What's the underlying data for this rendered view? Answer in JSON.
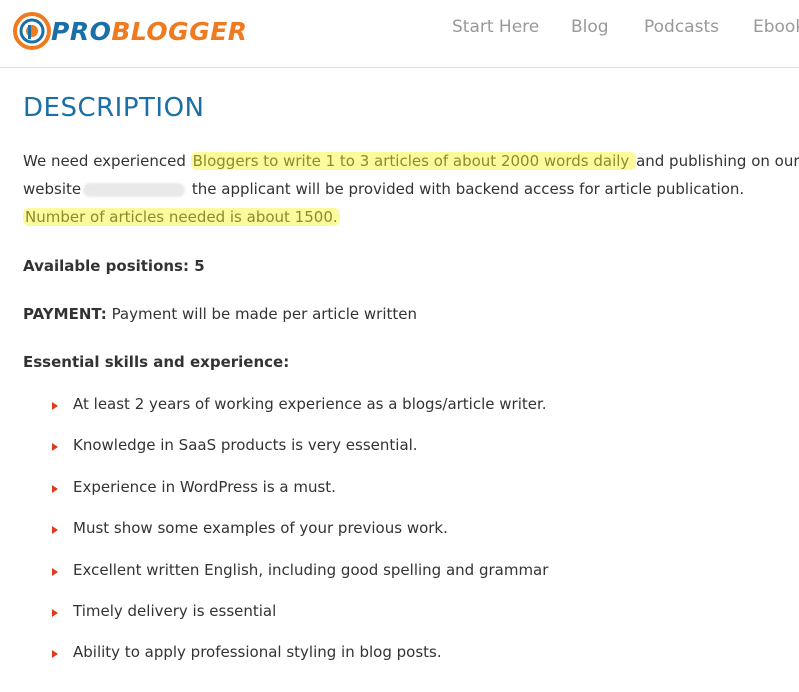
{
  "header": {
    "logo": {
      "pro": "PRO",
      "blogger": "BLOGGER"
    },
    "nav": [
      {
        "label": "Start Here"
      },
      {
        "label": "Blog"
      },
      {
        "label": "Podcasts"
      },
      {
        "label": "Ebook"
      }
    ]
  },
  "main": {
    "title": "DESCRIPTION",
    "intro": {
      "part1": "We need experienced ",
      "highlight1": "Bloggers to write 1 to 3 articles of about 2000 words daily ",
      "part2": "and publishing on our website",
      "part3": " the applicant will be provided with backend access for article publication.",
      "highlight2": "Number of articles needed is about 1500."
    },
    "positions": "Available positions: 5",
    "payment_label": "PAYMENT:",
    "payment_text": " Payment will be made per article written",
    "skills_heading": "Essential skills and experience:",
    "skills": [
      "At least 2 years of working experience as a  blogs/article writer.",
      "Knowledge in SaaS products is very essential.",
      "Experience in WordPress is a must.",
      "Must show some examples of your previous work.",
      "Excellent written English, including good spelling and grammar",
      "Timely delivery is essential",
      "Ability to apply professional styling in blog posts."
    ]
  },
  "colors": {
    "brand_blue": "#1a6fa6",
    "brand_orange": "#f07a1f",
    "highlight": "#fbfb9e",
    "bullet": "#e03a1e"
  }
}
